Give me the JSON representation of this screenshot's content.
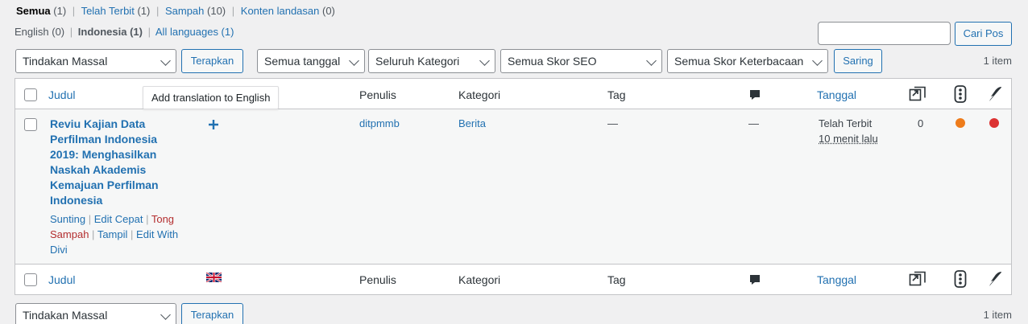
{
  "views": {
    "all_label": "Semua",
    "all_count": "(1)",
    "published_label": "Telah Terbit",
    "published_count": "(1)",
    "trash_label": "Sampah",
    "trash_count": "(10)",
    "cornerstone_label": "Konten landasan",
    "cornerstone_count": "(0)",
    "separator": "|"
  },
  "languages": {
    "english": "English (0)",
    "indonesia": "Indonesia (1)",
    "all": "All languages (1)",
    "separator": "|"
  },
  "search": {
    "placeholder": "",
    "button_label": "Cari Pos"
  },
  "filters": {
    "bulk_action": "Tindakan Massal",
    "apply_label": "Terapkan",
    "date": "Semua tanggal",
    "category": "Seluruh Kategori",
    "seo": "Semua Skor SEO",
    "readability": "Semua Skor Keterbacaan",
    "filter_label": "Saring",
    "items_count": "1 item"
  },
  "columns": {
    "title": "Judul",
    "author": "Penulis",
    "category": "Kategori",
    "tag": "Tag",
    "date": "Tanggal"
  },
  "tooltip": "Add translation to English",
  "post": {
    "title": "Reviu Kajian Data Perfilman Indonesia 2019: Menghasilkan Naskah Akademis Kemajuan Perfilman Indonesia",
    "action_edit": "Sunting",
    "action_quick_edit": "Edit Cepat",
    "action_trash": "Tong Sampah",
    "action_view": "Tampil",
    "action_divi": "Edit With Divi",
    "author": "ditpmmb",
    "category": "Berita",
    "tags": "—",
    "comments": "—",
    "status": "Telah Terbit",
    "time_ago": "10 menit lalu",
    "links": "0",
    "seo_color": "#ee7c1b",
    "readability_color": "#dc3232"
  },
  "bottom": {
    "bulk_action": "Tindakan Massal",
    "apply_label": "Terapkan",
    "items_count": "1 item"
  }
}
